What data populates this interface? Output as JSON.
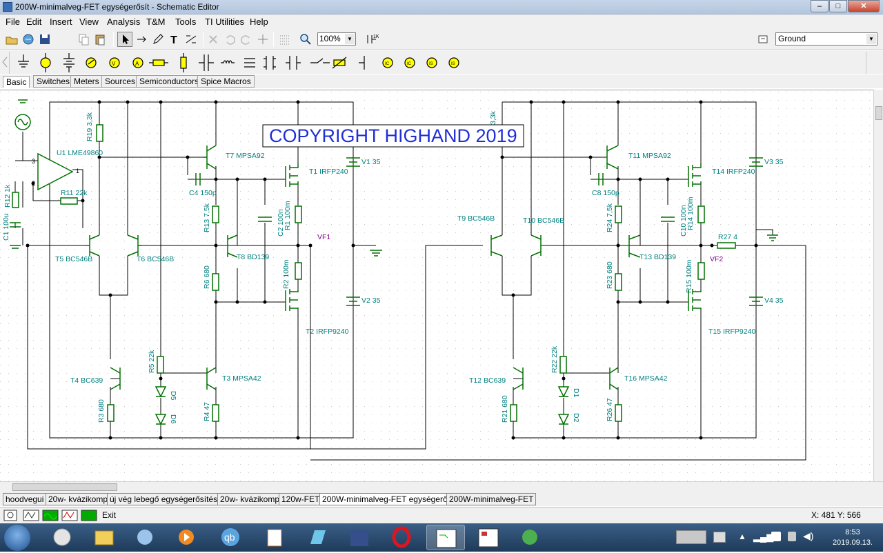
{
  "window": {
    "title": "200W-minimalveg-FET egységerősít - Schematic Editor"
  },
  "menu": [
    "File",
    "Edit",
    "Insert",
    "View",
    "Analysis",
    "T&M",
    "Tools",
    "TI Utilities",
    "Help"
  ],
  "toolbar": {
    "zoom": "100%",
    "ground_select": "Ground"
  },
  "palette_tabs": [
    "Basic",
    "Switches",
    "Meters",
    "Sources",
    "Semiconductors",
    "Spice Macros"
  ],
  "palette_selected": "Basic",
  "schematic": {
    "copyright": "COPYRIGHT HIGHAND 2019",
    "left": {
      "U1": "U1 LME49860",
      "R19": "R19 3,3k",
      "R11": "R11 22k",
      "R12": "R12 1k",
      "C1": "C1 100u",
      "T7": "T7 MPSA92",
      "C4": "C4 150p",
      "T1": "T1 IRFP240",
      "V1": "V1 35",
      "T5": "T5 BC546B",
      "T6": "T6 BC546B",
      "R13": "R13 7,5k",
      "C2": "C2 100n",
      "R1": "R1 100m",
      "VF1": "VF1",
      "T8": "T8 BD139",
      "R6": "R6 680",
      "R2": "R2 100m",
      "V2": "V2 35",
      "T2": "T2 IRFP9240",
      "R5": "R5 22k",
      "D5": "D5",
      "D6": "D6",
      "T4": "T4 BC639",
      "T3": "T3 MPSA42",
      "R3": "R3 680",
      "R4": "R4 47"
    },
    "right": {
      "R20": "3,3k",
      "T11": "T11 MPSA92",
      "C8": "C8 150p",
      "T14": "T14 IRFP240",
      "V3": "V3 35",
      "T9": "T9 BC546B",
      "T10": "T10 BC546B",
      "R24": "R24 7,5k",
      "C10": "C10 100n",
      "R14": "R14 100m",
      "R27": "R27 4",
      "T13": "T13 BD139",
      "VF2": "VF2",
      "R23": "R23 680",
      "R15": "R15 100m",
      "V4": "V4 35",
      "T15": "T15 IRFP9240",
      "R22": "R22 22k",
      "D1": "D1",
      "D2": "D2",
      "T12": "T12 BC639",
      "T16": "T16 MPSA42",
      "R21": "R21 680",
      "R26": "R26 47"
    }
  },
  "sheet_tabs": [
    "hoodvegui",
    "20w- kvázikomp",
    "új vég lebegő egységerősítéssel",
    "20w- kvázikomp",
    "120w-FET",
    "200W-minimalveg-FET egységerősít",
    "200W-minimalveg-FET"
  ],
  "sheet_selected": "200W-minimalveg-FET egységerősít",
  "status": {
    "exit_label": "Exit",
    "coords": "X: 481  Y: 566"
  },
  "taskbar": {
    "time": "8:53",
    "date": "2019.09.13."
  },
  "colors": {
    "wire": "#000000",
    "component": "#008000",
    "label": "#008080",
    "probe": "#800080",
    "copyright": "#1f2fd6"
  }
}
